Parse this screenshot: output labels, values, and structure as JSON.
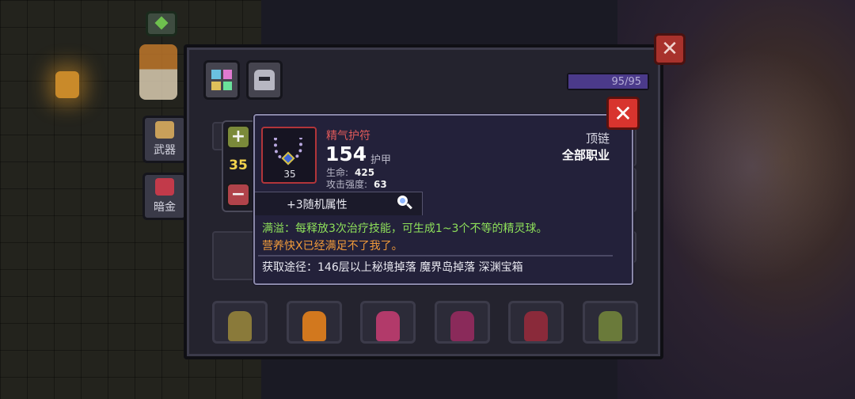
{
  "sidebar": {
    "weapon_label": "武器",
    "dark_gold_label": "暗金"
  },
  "header": {
    "capacity": "95/95",
    "capacity_fraction": 1.0
  },
  "stepper": {
    "level": "35"
  },
  "item": {
    "name": "精气护符",
    "level": "35",
    "value": "154",
    "value_label": "护甲",
    "stats": [
      {
        "label": "生命:",
        "value": "425"
      },
      {
        "label": "攻击强度:",
        "value": "63"
      }
    ],
    "slot_type": "顶链",
    "class_requirement": "全部职业",
    "random_attributes": "+3随机属性",
    "effect": "满溢：每释放3次治疗技能，可生成1~3个不等的精灵球。",
    "flavor": "营养快X已经满足不了我了。",
    "source": "获取途径：146层以上秘境掉落 魔界岛掉落 深渊宝箱"
  },
  "colors": {
    "item_name": "#e05a5a",
    "effect": "#8ee05a",
    "flavor": "#f09a3a",
    "level": "#f2d24c",
    "close": "#d8342e"
  },
  "icons": {
    "plus": "+",
    "minus": "−",
    "close": "✕"
  }
}
